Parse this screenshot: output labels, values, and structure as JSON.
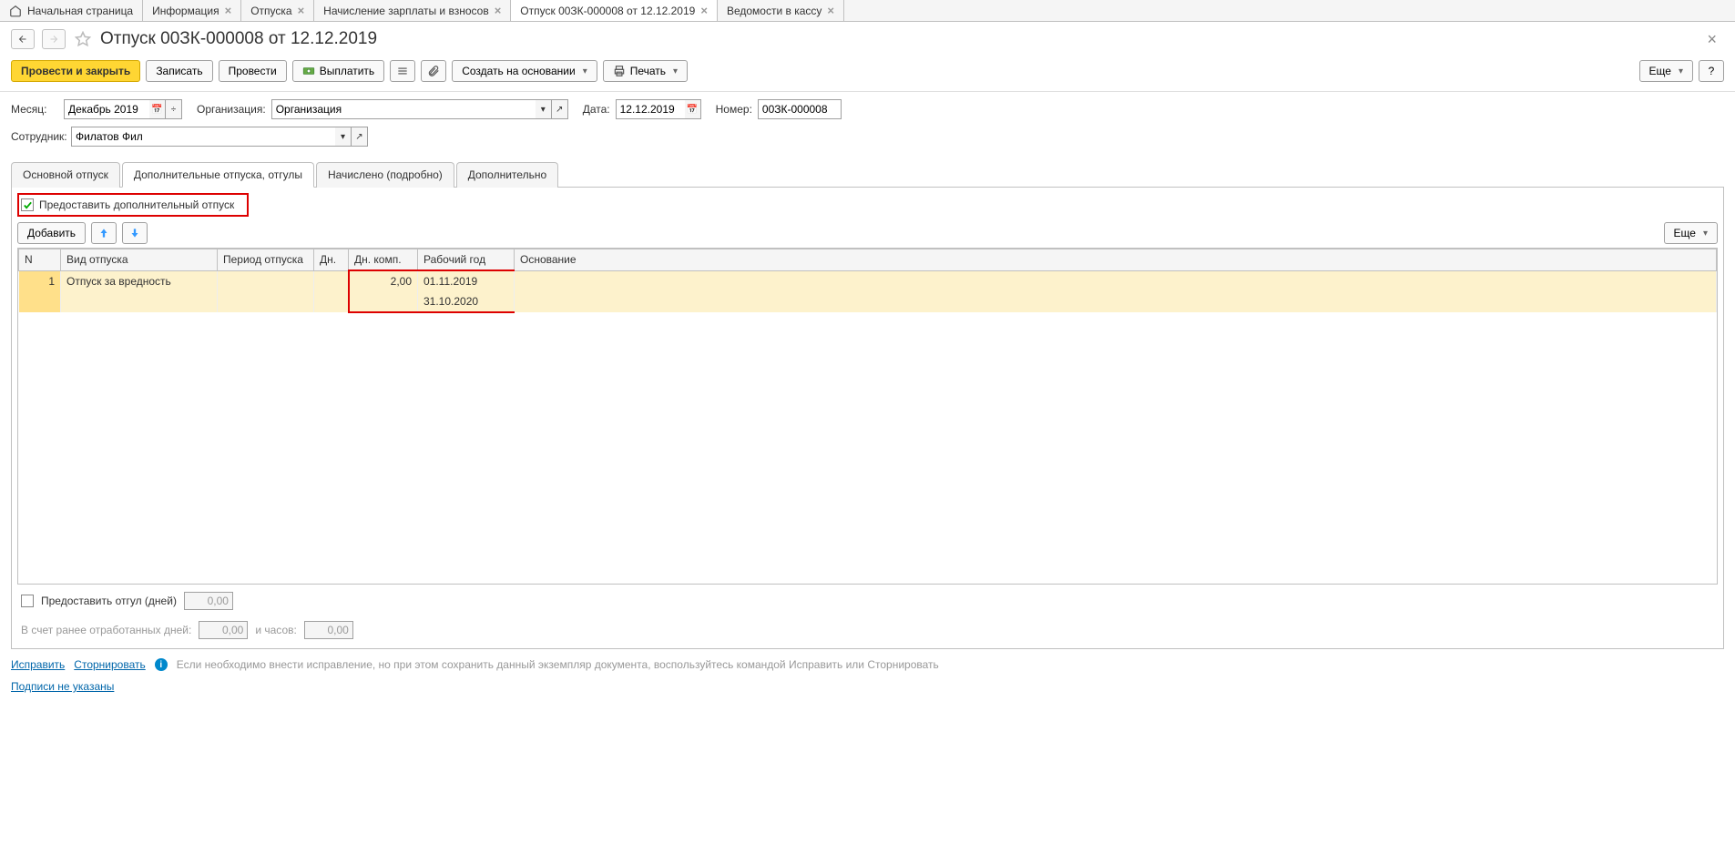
{
  "tabs": {
    "home": "Начальная страница",
    "info": "Информация",
    "vacations": "Отпуска",
    "payroll": "Начисление зарплаты и взносов",
    "current": "Отпуск 00ЗК-000008 от 12.12.2019",
    "statements": "Ведомости в кассу"
  },
  "page": {
    "title": "Отпуск 00ЗК-000008 от 12.12.2019"
  },
  "toolbar": {
    "submit": "Провести и закрыть",
    "save": "Записать",
    "post": "Провести",
    "pay": "Выплатить",
    "create_based": "Создать на основании",
    "print": "Печать",
    "more": "Еще"
  },
  "form": {
    "month_label": "Месяц:",
    "month_value": "Декабрь 2019",
    "org_label": "Организация:",
    "org_value": "Организация",
    "date_label": "Дата:",
    "date_value": "12.12.2019",
    "number_label": "Номер:",
    "number_value": "00ЗК-000008",
    "employee_label": "Сотрудник:",
    "employee_value": "Филатов Фил"
  },
  "sub_tabs": {
    "main": "Основной отпуск",
    "additional": "Дополнительные отпуска, отгулы",
    "accrued": "Начислено (подробно)",
    "extra": "Дополнительно"
  },
  "panel": {
    "provide_additional": "Предоставить дополнительный отпуск",
    "add": "Добавить",
    "more": "Еще"
  },
  "table": {
    "headers": {
      "n": "N",
      "type": "Вид отпуска",
      "period": "Период отпуска",
      "days": "Дн.",
      "days_comp": "Дн. комп.",
      "work_year": "Рабочий год",
      "reason": "Основание"
    },
    "row": {
      "n": "1",
      "type": "Отпуск за вредность",
      "days_comp": "2,00",
      "year_from": "01.11.2019",
      "year_to": "31.10.2020"
    }
  },
  "bottom": {
    "provide_compensatory": "Предоставить отгул (дней)",
    "compensatory_value": "0,00",
    "prev_days_label": "В счет ранее отработанных дней:",
    "prev_days_value": "0,00",
    "hours_label": "и часов:",
    "hours_value": "0,00"
  },
  "footer": {
    "fix": "Исправить",
    "reverse": "Сторнировать",
    "info_text": "Если необходимо внести исправление, но при этом сохранить данный экземпляр документа, воспользуйтесь командой Исправить или Сторнировать",
    "signatures": "Подписи не указаны"
  }
}
